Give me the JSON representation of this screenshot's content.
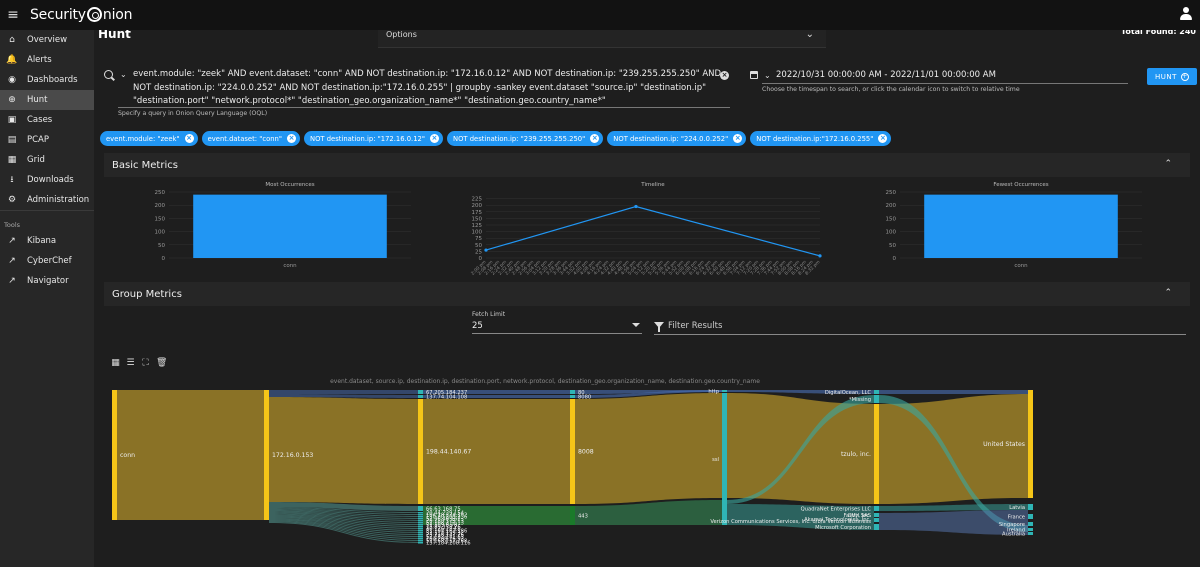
{
  "app": {
    "brand_left": "Security",
    "brand_right": "nion"
  },
  "sidebar": {
    "items": [
      {
        "label": "Overview",
        "icon": "home-icon",
        "glyph": "⌂"
      },
      {
        "label": "Alerts",
        "icon": "bell-icon",
        "glyph": "🔔"
      },
      {
        "label": "Dashboards",
        "icon": "dashboard-icon",
        "glyph": "◉"
      },
      {
        "label": "Hunt",
        "icon": "crosshairs-icon",
        "glyph": "⊕"
      },
      {
        "label": "Cases",
        "icon": "briefcase-icon",
        "glyph": "▣"
      },
      {
        "label": "PCAP",
        "icon": "file-icon",
        "glyph": "▤"
      },
      {
        "label": "Grid",
        "icon": "grid-icon",
        "glyph": "▦"
      },
      {
        "label": "Downloads",
        "icon": "download-icon",
        "glyph": "⭳"
      },
      {
        "label": "Administration",
        "icon": "admin-icon",
        "glyph": "⚙"
      }
    ],
    "tools_label": "Tools",
    "tools": [
      {
        "label": "Kibana",
        "icon": "external-link-icon",
        "glyph": "↗"
      },
      {
        "label": "CyberChef",
        "icon": "external-link-icon",
        "glyph": "↗"
      },
      {
        "label": "Navigator",
        "icon": "external-link-icon",
        "glyph": "↗"
      }
    ],
    "active": "Hunt"
  },
  "header": {
    "title": "Hunt",
    "options_label": "Options",
    "total_found": "Total Found: 240"
  },
  "query": {
    "text": "event.module: \"zeek\" AND event.dataset: \"conn\" AND NOT destination.ip: \"172.16.0.12\" AND NOT destination.ip: \"239.255.255.250\" AND NOT destination.ip: \"224.0.0.252\" AND NOT destination.ip:\"172.16.0.255\" | groupby -sankey event.dataset \"source.ip\" \"destination.ip\" \"destination.port\" \"network.protocol*\" \"destination_geo.organization_name*\" \"destination.geo.country_name*\"",
    "hint": "Specify a query in Onion Query Language (OQL)"
  },
  "date": {
    "range": "2022/10/31 00:00:00 AM - 2022/11/01 00:00:00 AM",
    "hint": "Choose the timespan to search, or click the calendar icon to switch to relative time",
    "hunt_label": "HUNT"
  },
  "chips": [
    "event.module: \"zeek\"",
    "event.dataset: \"conn\"",
    "NOT destination.ip: \"172.16.0.12\"",
    "NOT destination.ip: \"239.255.255.250\"",
    "NOT destination.ip: \"224.0.0.252\"",
    "NOT destination.ip:\"172.16.0.255\""
  ],
  "basic_metrics": {
    "title": "Basic Metrics"
  },
  "chart_data": [
    {
      "type": "bar",
      "title": "Most Occurrences",
      "categories": [
        "conn"
      ],
      "values": [
        240
      ],
      "ylim": [
        0,
        250
      ],
      "yticks": [
        0,
        50,
        100,
        150,
        200,
        250
      ],
      "color": "#2196f3"
    },
    {
      "type": "line",
      "title": "Timeline",
      "x": [
        "2:00 pm",
        "2:08 pm",
        "2:16 pm",
        "2:24 pm",
        "2:32 pm",
        "2:40 pm",
        "2:48 pm",
        "2:56 pm",
        "3:04 pm",
        "3:12 pm",
        "3:20 pm",
        "3:28 pm",
        "3:36 pm",
        "3:44 pm",
        "3:52 pm",
        "4:00 pm",
        "4:08 pm",
        "4:16 pm",
        "4:24 pm",
        "4:32 pm",
        "4:40 pm",
        "4:48 pm",
        "4:56 pm",
        "5:04 pm",
        "5:12 pm",
        "5:20 pm",
        "5:28 pm",
        "5:36 pm",
        "5:44 pm",
        "5:52 pm",
        "6:00 pm",
        "6:08 pm",
        "6:16 pm",
        "6:24 pm",
        "6:32 pm",
        "6:40 pm",
        "6:48 pm",
        "6:56 pm",
        "7:04 pm",
        "7:12 pm",
        "7:20 pm",
        "7:28 pm",
        "7:36 pm",
        "7:44 pm",
        "7:52 pm",
        "8:00 pm",
        "8:08 pm",
        "8:16 pm",
        "8:24 pm",
        "8:32 pm"
      ],
      "points": [
        {
          "x_index": 0,
          "y": 30
        },
        {
          "x_index": 22,
          "y": 195
        },
        {
          "x_index": 49,
          "y": 8
        }
      ],
      "ylim": [
        0,
        250
      ],
      "yticks": [
        0,
        25,
        50,
        75,
        100,
        125,
        150,
        175,
        200,
        225
      ],
      "color": "#2196f3"
    },
    {
      "type": "bar",
      "title": "Fewest Occurrences",
      "categories": [
        "conn"
      ],
      "values": [
        240
      ],
      "ylim": [
        0,
        250
      ],
      "yticks": [
        0,
        50,
        100,
        150,
        200,
        250
      ],
      "color": "#2196f3"
    }
  ],
  "group_metrics": {
    "title": "Group Metrics",
    "fetch_label": "Fetch Limit",
    "fetch_value": "25",
    "filter_placeholder": "Filter Results",
    "toolbar_icons": [
      {
        "icon": "table-icon",
        "glyph": "▦"
      },
      {
        "icon": "list-icon",
        "glyph": "☰"
      },
      {
        "icon": "fullscreen-icon",
        "glyph": "⛶"
      },
      {
        "icon": "trash-icon",
        "glyph": "🗑"
      }
    ]
  },
  "sankey": {
    "title": "event.dataset, source.ip, destination.ip, destination.port, network.protocol, destination_geo.organization_name, destination.geo.country_name",
    "columns": [
      {
        "nodes": [
          {
            "label": "conn",
            "big": true
          }
        ]
      },
      {
        "nodes": [
          {
            "label": "172.16.0.153",
            "big": true
          }
        ]
      },
      {
        "nodes": [
          {
            "label": "67.205.184.237"
          },
          {
            "label": "137.74.104.108"
          },
          {
            "label": "198.44.140.67",
            "big": true
          },
          {
            "label": "66.63.168.75"
          },
          {
            "label": "20.44.229.154"
          },
          {
            "label": "104.18.224.102"
          },
          {
            "label": "130.80.205.236"
          },
          {
            "label": "52.96.40.162"
          },
          {
            "label": "20.189.173.13"
          },
          {
            "label": "52.108.213.13"
          },
          {
            "label": "52.109.8.78"
          },
          {
            "label": "13.89.178.26"
          },
          {
            "label": "40.126.28.18"
          },
          {
            "label": "51.104.167.186"
          },
          {
            "label": "52.114.159.32"
          },
          {
            "label": "23.216.147.76"
          },
          {
            "label": "52.182.141.63"
          },
          {
            "label": "104.208.16.93"
          },
          {
            "label": "52.168.117.168"
          },
          {
            "label": "137.184.208.116"
          }
        ]
      },
      {
        "nodes": [
          {
            "label": "80"
          },
          {
            "label": "8080"
          },
          {
            "label": "8008",
            "big": true
          },
          {
            "label": "443"
          }
        ]
      },
      {
        "nodes": [
          {
            "label": "http"
          },
          {
            "label": "ssl"
          }
        ]
      },
      {
        "nodes": [
          {
            "label": "DigitalOcean, LLC"
          },
          {
            "label": "*Missing"
          },
          {
            "label": "tzulo, inc.",
            "big": true
          },
          {
            "label": "QuadraNet Enterprises LLC"
          },
          {
            "label": "Fastly, Inc."
          },
          {
            "label": "Akamai Technologies, Inc."
          },
          {
            "label": "Verizon Communications Services, Inc. d/b/a Verizon Business"
          },
          {
            "label": "OVH SAS"
          },
          {
            "label": "Microsoft Corporation"
          }
        ]
      },
      {
        "nodes": [
          {
            "label": "United States",
            "big": true
          },
          {
            "label": "Latvia"
          },
          {
            "label": "France"
          },
          {
            "label": "Singapore"
          },
          {
            "label": "Ireland"
          },
          {
            "label": "Australia"
          }
        ]
      }
    ]
  }
}
